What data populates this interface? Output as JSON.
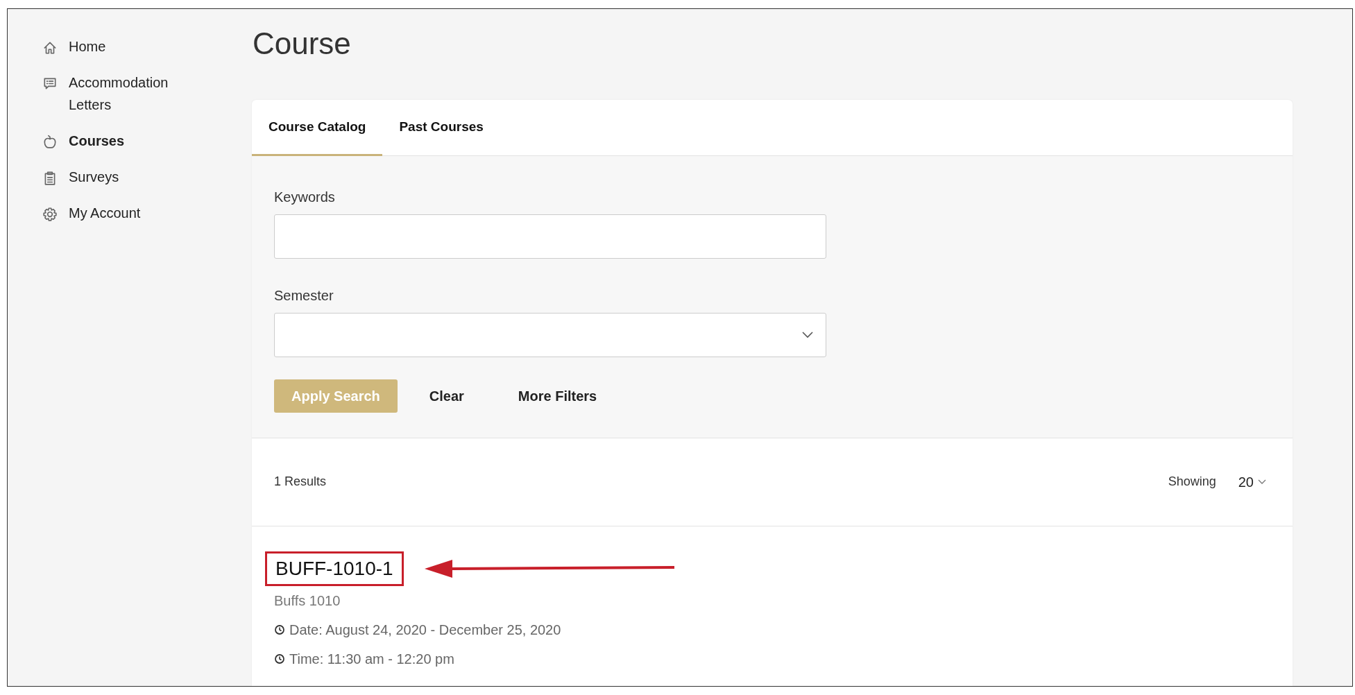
{
  "sidebar": {
    "items": [
      {
        "label": "Home",
        "selected": false
      },
      {
        "label": "Accommodation Letters",
        "selected": false
      },
      {
        "label": "Courses",
        "selected": true
      },
      {
        "label": "Surveys",
        "selected": false
      },
      {
        "label": "My Account",
        "selected": false
      }
    ]
  },
  "page_title": "Course",
  "tabs": [
    {
      "label": "Course Catalog",
      "selected": true
    },
    {
      "label": "Past Courses",
      "selected": false
    }
  ],
  "filters": {
    "keywords": {
      "label": "Keywords"
    },
    "semester": {
      "label": "Semester"
    },
    "buttons": [
      {
        "label": "Apply Search",
        "kind": "primary"
      },
      {
        "label": "Clear",
        "kind": "link"
      },
      {
        "label": "More Filters",
        "kind": "link"
      }
    ]
  },
  "results": {
    "count": "1 Results",
    "showing_label": "Showing",
    "page_size": "20"
  },
  "courses": [
    {
      "code": "BUFF-1010-1",
      "name": "Buffs 1010",
      "date": "Date: August 24, 2020 - December 25, 2020",
      "time": "Time: 11:30 am - 12:20 pm",
      "highlighted": true
    }
  ]
}
